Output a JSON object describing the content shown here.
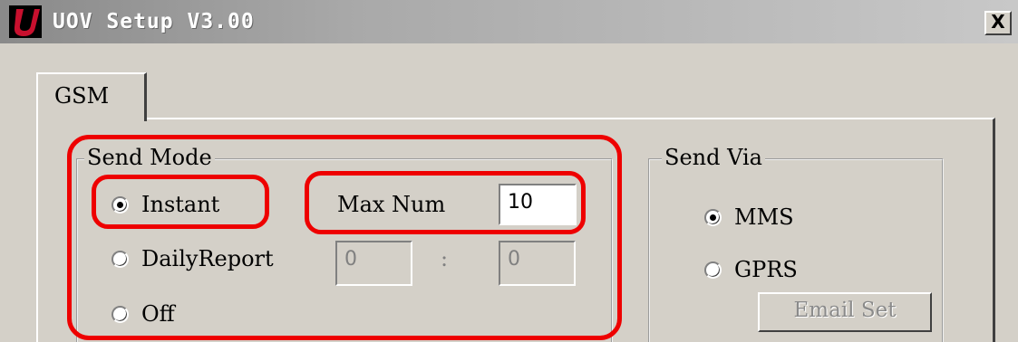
{
  "window": {
    "title": "UOV Setup V3.00",
    "close_label": "X",
    "app_icon": "red-u-logo",
    "close_icon": "close-icon"
  },
  "tabs": [
    {
      "label": "GSM",
      "selected": true
    }
  ],
  "send_mode": {
    "label": "Send Mode",
    "options": [
      {
        "label": "Instant",
        "checked": true
      },
      {
        "label": "DailyReport",
        "checked": false
      },
      {
        "label": "Off",
        "checked": false
      }
    ],
    "max_num_label": "Max Num",
    "max_num_value": "10",
    "daily_hour": "0",
    "daily_separator": ":",
    "daily_minute": "0"
  },
  "send_via": {
    "label": "Send Via",
    "options": [
      {
        "label": "MMS",
        "checked": true
      },
      {
        "label": "GPRS",
        "checked": false
      }
    ],
    "email_set_label": "Email Set"
  },
  "colors": {
    "highlight": "#ee0000",
    "face": "#d4d0c8",
    "icon_red": "#c8102e"
  }
}
